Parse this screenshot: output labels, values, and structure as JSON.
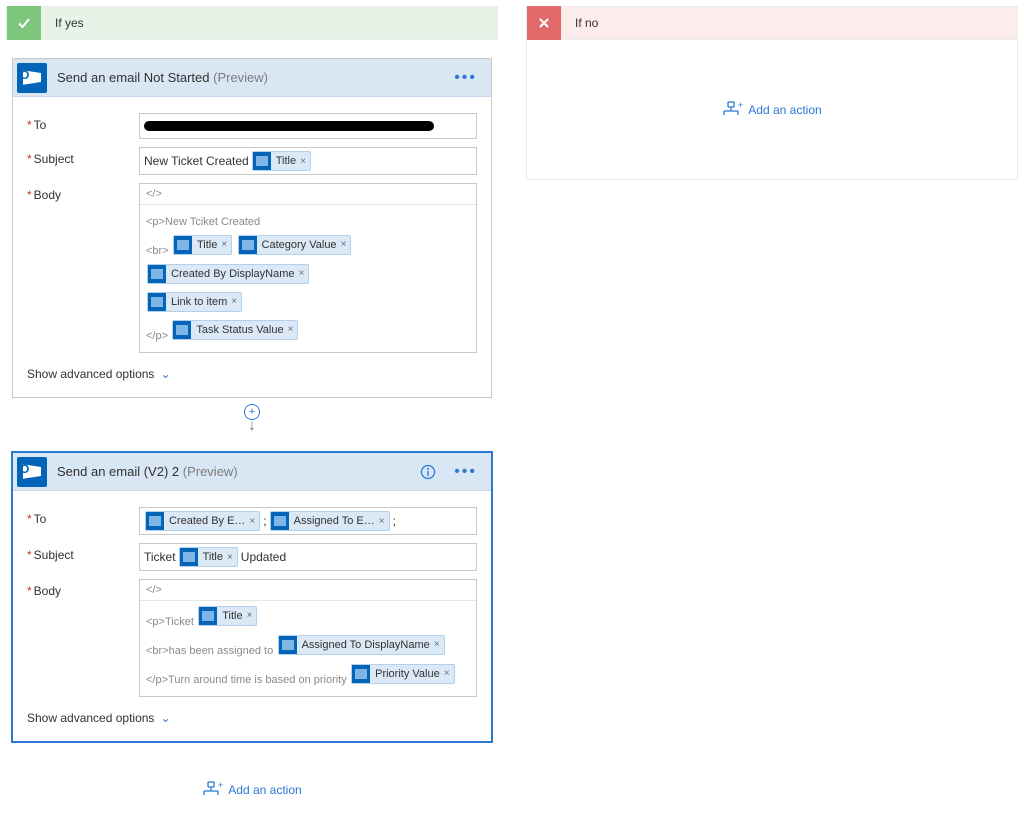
{
  "yes": {
    "label": "If yes",
    "card1": {
      "title": "Send an email Not Started",
      "preview": "(Preview)",
      "to_label": "To",
      "subject_label": "Subject",
      "body_label": "Body",
      "subject_prefix": "New Ticket Created",
      "subject_token": "Title",
      "body_code_open": "</>",
      "body_line1": "<p>New Tciket Created",
      "body_line2_prefix": "<br>",
      "body_line3_close": "</p>",
      "tokens": {
        "title": "Title",
        "category": "Category Value",
        "createdby": "Created By DisplayName",
        "link": "Link to item",
        "taskstatus": "Task Status Value"
      },
      "advanced": "Show advanced options"
    },
    "card2": {
      "title": "Send an email (V2) 2",
      "preview": "(Preview)",
      "to_label": "To",
      "subject_label": "Subject",
      "body_label": "Body",
      "to_sep": ";",
      "tokens": {
        "createdby_email": "Created By E…",
        "assigned_email": "Assigned To E…",
        "title": "Title",
        "assigned_dn": "Assigned To DisplayName",
        "priority": "Priority Value"
      },
      "subject_prefix": "Ticket",
      "subject_suffix": "Updated",
      "body_code_open": "</>",
      "body_line1_prefix": "<p>Ticket",
      "body_line2_prefix": "<br>has been assigned to",
      "body_line3_prefix": "</p>Turn around time is based on priority",
      "advanced": "Show advanced options"
    },
    "add_action": "Add an action"
  },
  "no": {
    "label": "If no",
    "add_action": "Add an action"
  }
}
